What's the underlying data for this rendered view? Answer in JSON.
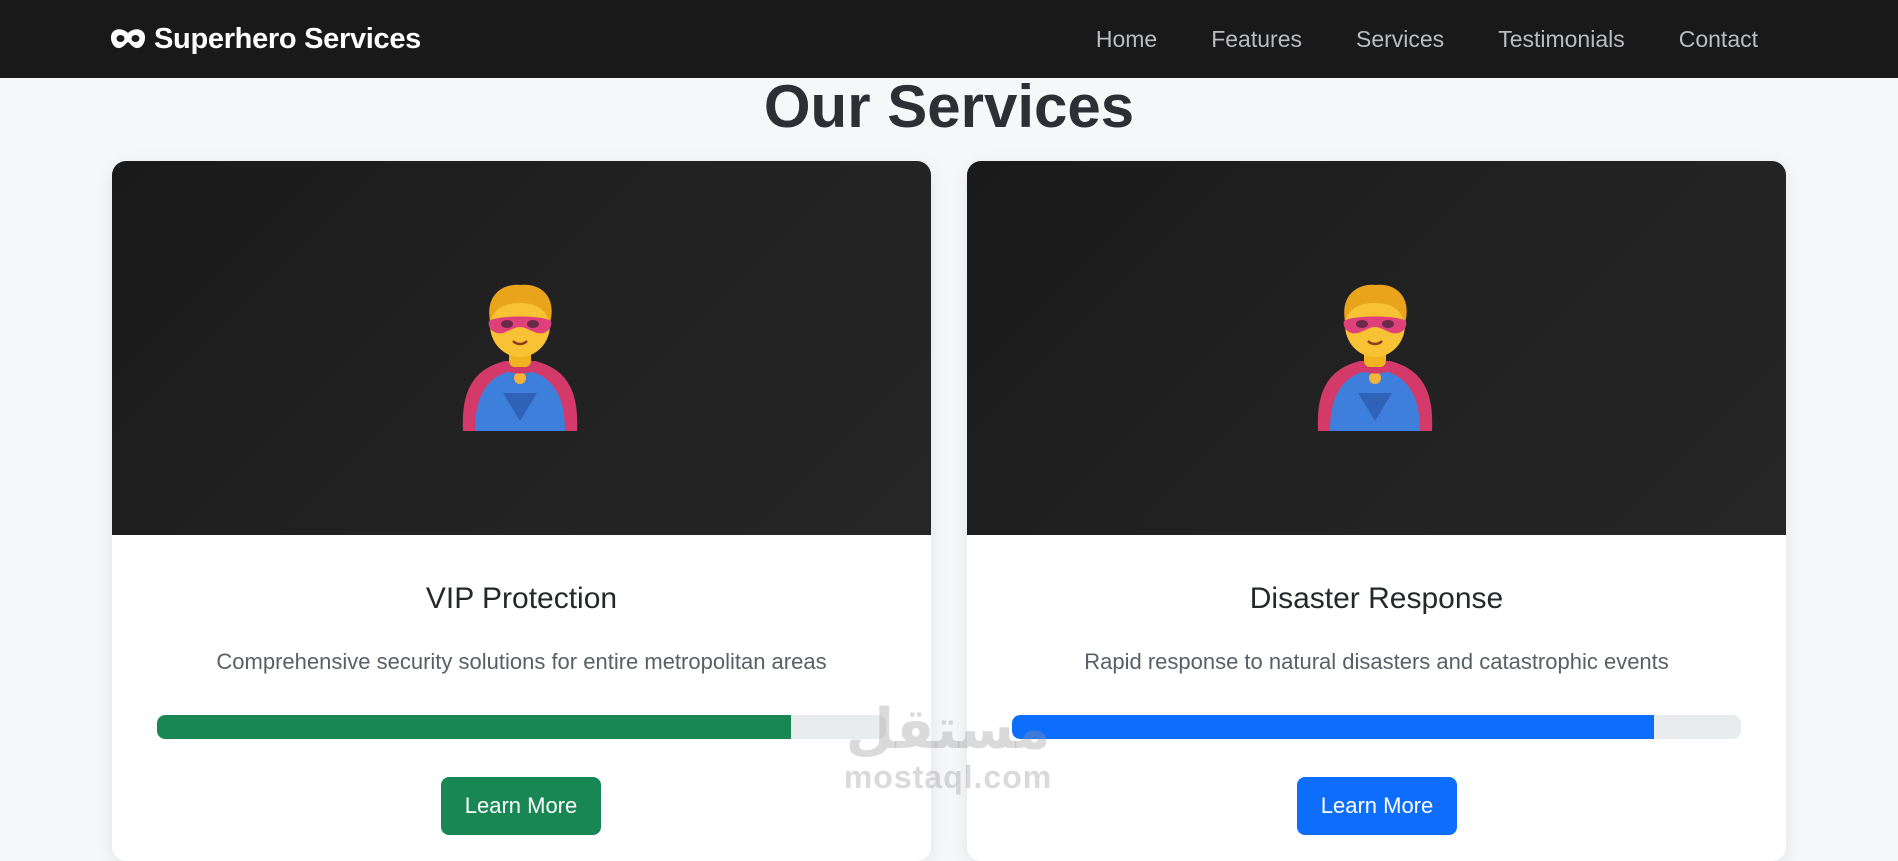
{
  "navbar": {
    "brand": "Superhero Services",
    "brand_icon": "mask-icon",
    "links": [
      "Home",
      "Features",
      "Services",
      "Testimonials",
      "Contact"
    ]
  },
  "services": {
    "title": "Our Services",
    "cards": [
      {
        "title": "VIP Protection",
        "description": "Comprehensive security solutions for entire metropolitan areas",
        "progress": 0.87,
        "accent": "#198754",
        "button": "Learn More",
        "image_icon": "superhero-icon"
      },
      {
        "title": "Disaster Response",
        "description": "Rapid response to natural disasters and catastrophic events",
        "progress": 0.88,
        "accent": "#0d6efd",
        "button": "Learn More",
        "image_icon": "superhero-icon"
      }
    ]
  },
  "watermark": {
    "arabic": "مستقل",
    "latin": "mostaql.com"
  }
}
